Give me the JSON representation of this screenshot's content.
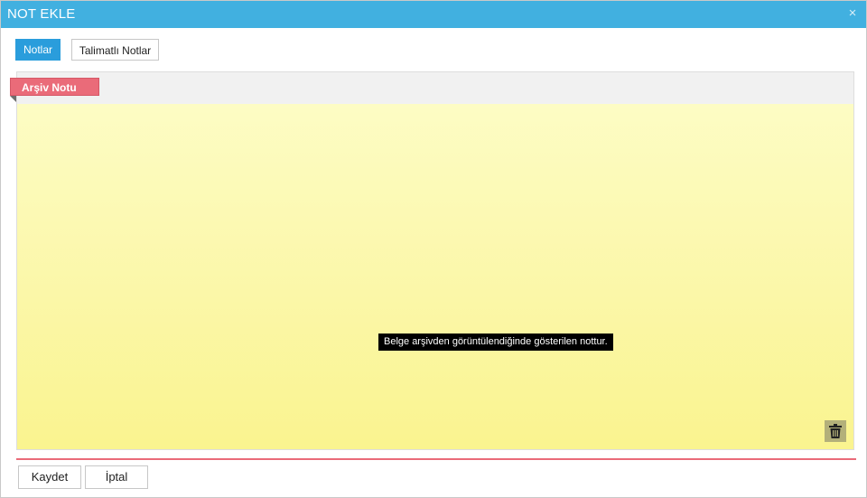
{
  "window": {
    "title": "NOT EKLE",
    "close_glyph": "×",
    "accent_color": "#41b0e0"
  },
  "tabs": [
    {
      "label": "Notlar",
      "active": true
    },
    {
      "label": "Talimatlı Notlar",
      "active": false
    }
  ],
  "note": {
    "label": "Arşiv Notu",
    "label_color": "#ea6b79",
    "tooltip": "Belge arşivden görüntülendiğinde gösterilen nottur.",
    "delete_icon": "trash-icon"
  },
  "footer": {
    "save_label": "Kaydet",
    "cancel_label": "İptal"
  }
}
